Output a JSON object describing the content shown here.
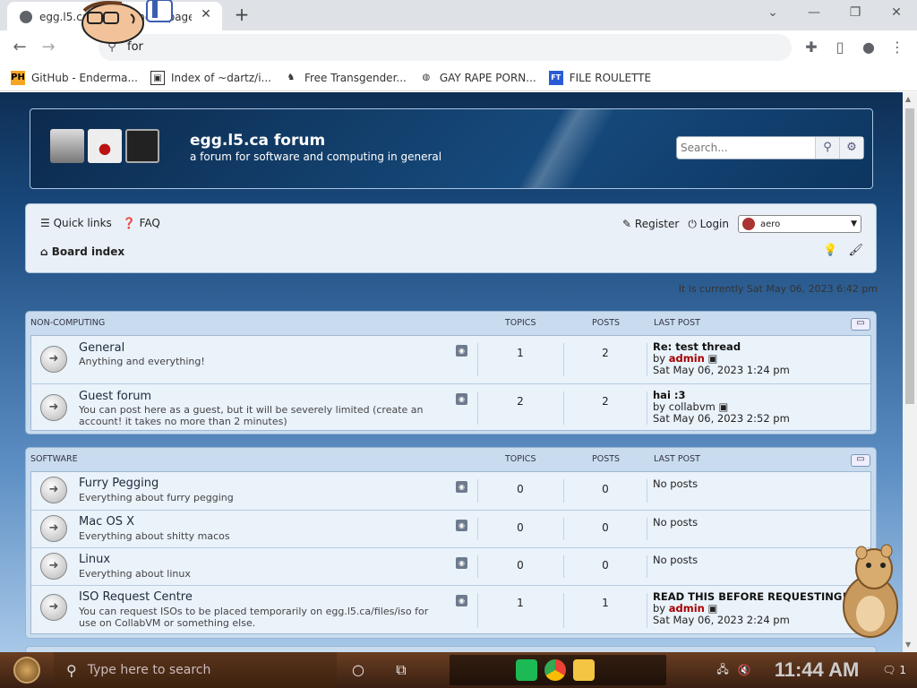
{
  "browser": {
    "tab_title": "egg.l5.ca forum - Index page",
    "tab_close": "✕",
    "new_tab": "+",
    "window_controls": [
      "⌄",
      "—",
      "❐",
      "✕"
    ],
    "address": "for",
    "nav": {
      "back": "←",
      "forward": "→"
    }
  },
  "bookmarks": [
    {
      "label": "GitHub - Enderma...",
      "icon_text": "PH",
      "icon_color": "#f5a623"
    },
    {
      "label": "Index of ~dartz/i...",
      "icon_text": "▣",
      "icon_color": "#333"
    },
    {
      "label": "Free Transgender...",
      "icon_text": "♞",
      "icon_color": "#555"
    },
    {
      "label": "GAY RAPE PORN...",
      "icon_text": "◍",
      "icon_color": "#666"
    },
    {
      "label": "FILE ROULETTE",
      "icon_text": "FT",
      "icon_color": "#2a5bd7"
    }
  ],
  "forum": {
    "site_name": "egg.l5.ca forum",
    "site_desc": "a forum for software and computing in general",
    "search_placeholder": "Search...",
    "quick_links": "Quick links",
    "faq": "FAQ",
    "register": "Register",
    "login": "Login",
    "style_select": "aero",
    "board_index": "Board index",
    "current_time": "It is currently Sat May 06, 2023 6:42 pm",
    "col_topics": "TOPICS",
    "col_posts": "POSTS",
    "col_last_post": "LAST POST",
    "by": "by",
    "categories": [
      {
        "name": "NON-COMPUTING",
        "forums": [
          {
            "name": "General",
            "desc": "Anything and everything!",
            "topics": "1",
            "posts": "2",
            "last_title": "Re: test thread",
            "last_author": "admin",
            "last_date": "Sat May 06, 2023 1:24 pm"
          },
          {
            "name": "Guest forum",
            "desc": "You can post here as a guest, but it will be severely limited (create an account! it takes no more than 2 minutes)",
            "topics": "2",
            "posts": "2",
            "last_title": "hai :3",
            "last_author": "collabvm",
            "last_date": "Sat May 06, 2023 2:52 pm"
          }
        ]
      },
      {
        "name": "SOFTWARE",
        "forums": [
          {
            "name": "Furry Pegging",
            "desc": "Everything about furry pegging",
            "topics": "0",
            "posts": "0",
            "last_none": "No posts"
          },
          {
            "name": "Mac OS X",
            "desc": "Everything about shitty macos",
            "topics": "0",
            "posts": "0",
            "last_none": "No posts"
          },
          {
            "name": "Linux",
            "desc": "Everything about linux",
            "topics": "0",
            "posts": "0",
            "last_none": "No posts"
          },
          {
            "name": "ISO Request Centre",
            "desc": "You can request ISOs to be placed temporarily on egg.l5.ca/files/iso for use on CollabVM or something else.",
            "topics": "1",
            "posts": "1",
            "last_title": "READ THIS BEFORE REQUESTING!",
            "last_author": "admin",
            "last_date": "Sat May 06, 2023 2:24 pm"
          }
        ]
      }
    ]
  },
  "taskbar": {
    "search_placeholder": "Type here to search",
    "clock": "11:44 AM",
    "notification_count": "1"
  },
  "colors": {
    "author": "#a50000",
    "header_bg": "#164a7c"
  }
}
